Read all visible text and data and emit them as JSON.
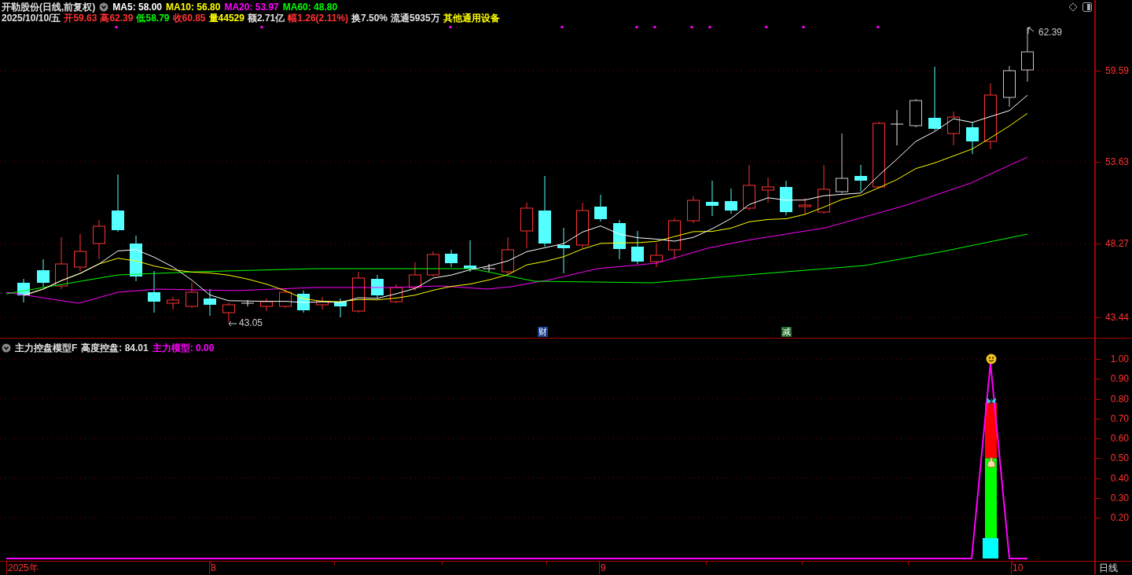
{
  "stock": {
    "title": "开勒股份(日线,前复权)",
    "ma_legend": [
      {
        "label": "MA5: 58.00",
        "color": "#ffffff"
      },
      {
        "label": "MA10: 56.80",
        "color": "#ffff00"
      },
      {
        "label": "MA20: 53.97",
        "color": "#ff00ff"
      },
      {
        "label": "MA60: 48.80",
        "color": "#00ff00"
      }
    ],
    "quote": [
      {
        "text": "2025/10/10/五",
        "color": "#e0e0e0"
      },
      {
        "text": "开59.63",
        "color": "#ff3232"
      },
      {
        "text": "高62.39",
        "color": "#ff3232"
      },
      {
        "text": "低58.79",
        "color": "#00ff00"
      },
      {
        "text": "收60.85",
        "color": "#ff3232"
      },
      {
        "text": "量44529",
        "color": "#ffff00"
      },
      {
        "text": "额2.71亿",
        "color": "#e0e0e0"
      },
      {
        "text": "幅1.26(2.11%)",
        "color": "#ff3232"
      },
      {
        "text": "换7.50%",
        "color": "#e0e0e0"
      },
      {
        "text": "流通5935万",
        "color": "#e0e0e0"
      },
      {
        "text": "其他通用设备",
        "color": "#ffff00"
      }
    ]
  },
  "price_chart": {
    "axis_labels": [
      "59.59",
      "53.63",
      "48.27",
      "43.44"
    ],
    "high_label": "62.39",
    "low_label": "43.05",
    "event_tags": [
      {
        "text": "财",
        "color": "#1a3f8f"
      },
      {
        "text": "减",
        "color": "#1f6b2a"
      }
    ]
  },
  "indicator": {
    "name": "主力控盘模型F",
    "readings": [
      {
        "text": "高度控盘: 84.01",
        "color": "#e0e0e0"
      },
      {
        "text": "主力模型: 0.00",
        "color": "#ff00ff"
      }
    ],
    "axis_labels": [
      "1.00",
      "0.90",
      "0.80",
      "0.70",
      "0.60",
      "0.50",
      "0.40",
      "0.30",
      "0.20"
    ]
  },
  "time_axis": {
    "labels": [
      "2025年",
      "8",
      "9",
      "10"
    ],
    "period": "日线"
  }
}
